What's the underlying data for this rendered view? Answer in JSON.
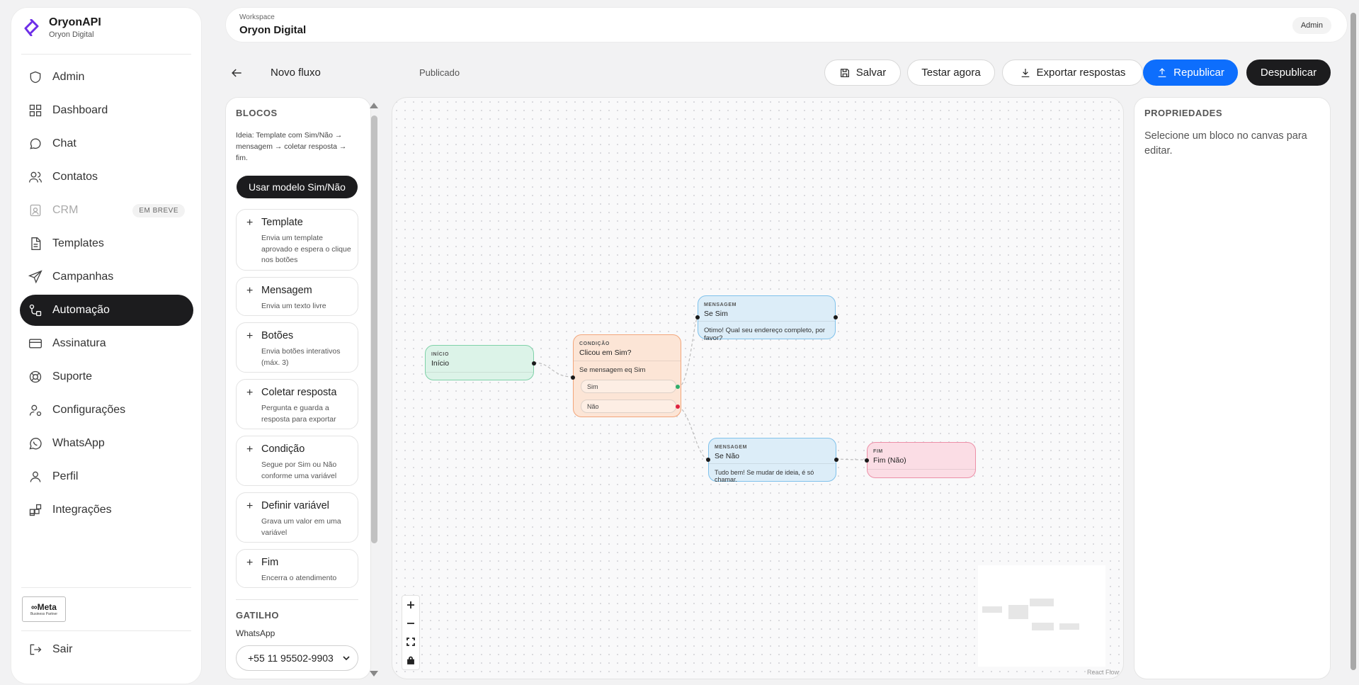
{
  "brand": {
    "name": "OryonAPI",
    "org": "Oryon Digital"
  },
  "nav": [
    {
      "label": "Admin",
      "icon": "shield-icon"
    },
    {
      "label": "Dashboard",
      "icon": "dashboard-icon"
    },
    {
      "label": "Chat",
      "icon": "chat-icon"
    },
    {
      "label": "Contatos",
      "icon": "users-icon"
    },
    {
      "label": "CRM",
      "icon": "crm-icon",
      "badge": "EM BREVE",
      "disabled": true
    },
    {
      "label": "Templates",
      "icon": "file-icon"
    },
    {
      "label": "Campanhas",
      "icon": "send-icon"
    },
    {
      "label": "Automação",
      "icon": "workflow-icon",
      "active": true
    },
    {
      "label": "Assinatura",
      "icon": "credit-card-icon"
    },
    {
      "label": "Suporte",
      "icon": "lifebuoy-icon"
    },
    {
      "label": "Configurações",
      "icon": "user-cog-icon"
    },
    {
      "label": "WhatsApp",
      "icon": "whatsapp-icon"
    },
    {
      "label": "Perfil",
      "icon": "user-icon"
    },
    {
      "label": "Integrações",
      "icon": "puzzle-icon"
    }
  ],
  "partner": {
    "logo": "∞Meta",
    "sub": "Business Partner"
  },
  "logout_label": "Sair",
  "header": {
    "workspace_label": "Workspace",
    "workspace_name": "Oryon Digital",
    "role": "Admin"
  },
  "toolbar": {
    "flow_name": "Novo fluxo",
    "status": "Publicado",
    "save": "Salvar",
    "test": "Testar agora",
    "export": "Exportar respostas",
    "republish": "Republicar",
    "unpublish": "Despublicar"
  },
  "blocks_panel": {
    "title": "BLOCOS",
    "hint": "Ideia: Template com Sim/Não → mensagem → coletar resposta → fim.",
    "template_button": "Usar modelo Sim/Não",
    "items": [
      {
        "title": "Template",
        "desc": "Envia um template aprovado e espera o clique nos botões"
      },
      {
        "title": "Mensagem",
        "desc": "Envia um texto livre"
      },
      {
        "title": "Botões",
        "desc": "Envia botões interativos (máx. 3)"
      },
      {
        "title": "Coletar resposta",
        "desc": "Pergunta e guarda a resposta para exportar"
      },
      {
        "title": "Condição",
        "desc": "Segue por Sim ou Não conforme uma variável"
      },
      {
        "title": "Definir variável",
        "desc": "Grava um valor em uma variável"
      },
      {
        "title": "Fim",
        "desc": "Encerra o atendimento"
      }
    ],
    "trigger_title": "GATILHO",
    "trigger_label": "WhatsApp",
    "trigger_value": "+55 11 95502-9903"
  },
  "canvas": {
    "nodes": {
      "start": {
        "type": "INÍCIO",
        "label": "Início"
      },
      "cond": {
        "type": "CONDIÇÃO",
        "label": "Clicou em Sim?",
        "rule": "Se mensagem eq Sim",
        "yes": "Sim",
        "no": "Não"
      },
      "msg_yes": {
        "type": "MENSAGEM",
        "label": "Se Sim",
        "text": "Otimo! Qual seu endereço completo, por favor?"
      },
      "msg_no": {
        "type": "MENSAGEM",
        "label": "Se Não",
        "text": "Tudo bem! Se mudar de ideia, é só chamar."
      },
      "end": {
        "type": "FIM",
        "label": "Fim (Não)"
      }
    },
    "attribution": "React Flow"
  },
  "properties": {
    "title": "PROPRIEDADES",
    "hint": "Selecione um bloco no canvas para editar."
  },
  "colors": {
    "accent": "#0d6efd",
    "dark": "#1c1c1e",
    "start_bg": "#dcf3e8",
    "start_border": "#7fd1a8",
    "cond_bg": "#fce5d6",
    "cond_border": "#f2a57a",
    "msg_bg": "#dcedf8",
    "msg_border": "#7fc1eb",
    "end_bg": "#fbdde5",
    "end_border": "#ec8fa7"
  }
}
